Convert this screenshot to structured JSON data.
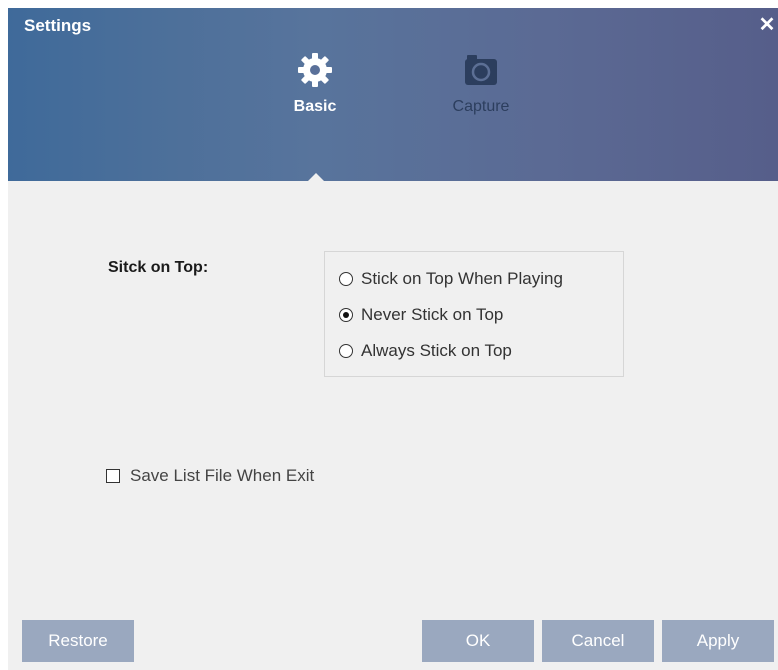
{
  "window": {
    "title": "Settings",
    "close_icon": "close-icon"
  },
  "tabs": [
    {
      "label": "Basic",
      "icon": "gear-icon",
      "selected": true
    },
    {
      "label": "Capture",
      "icon": "camera-icon",
      "selected": false
    }
  ],
  "basic": {
    "stick_on_top_label": "Sitck on Top:",
    "options": [
      {
        "label": "Stick on Top When Playing",
        "checked": false
      },
      {
        "label": "Never Stick on Top",
        "checked": true
      },
      {
        "label": "Always Stick on Top",
        "checked": false
      }
    ],
    "save_list_label": "Save List File When Exit",
    "save_list_checked": false
  },
  "buttons": {
    "restore": "Restore",
    "ok": "OK",
    "cancel": "Cancel",
    "apply": "Apply"
  },
  "colors": {
    "header_left": "#3f6a9a",
    "header_right": "#565e8a",
    "button_bg": "#9aa8bf",
    "body_bg": "#f0f0f0"
  }
}
